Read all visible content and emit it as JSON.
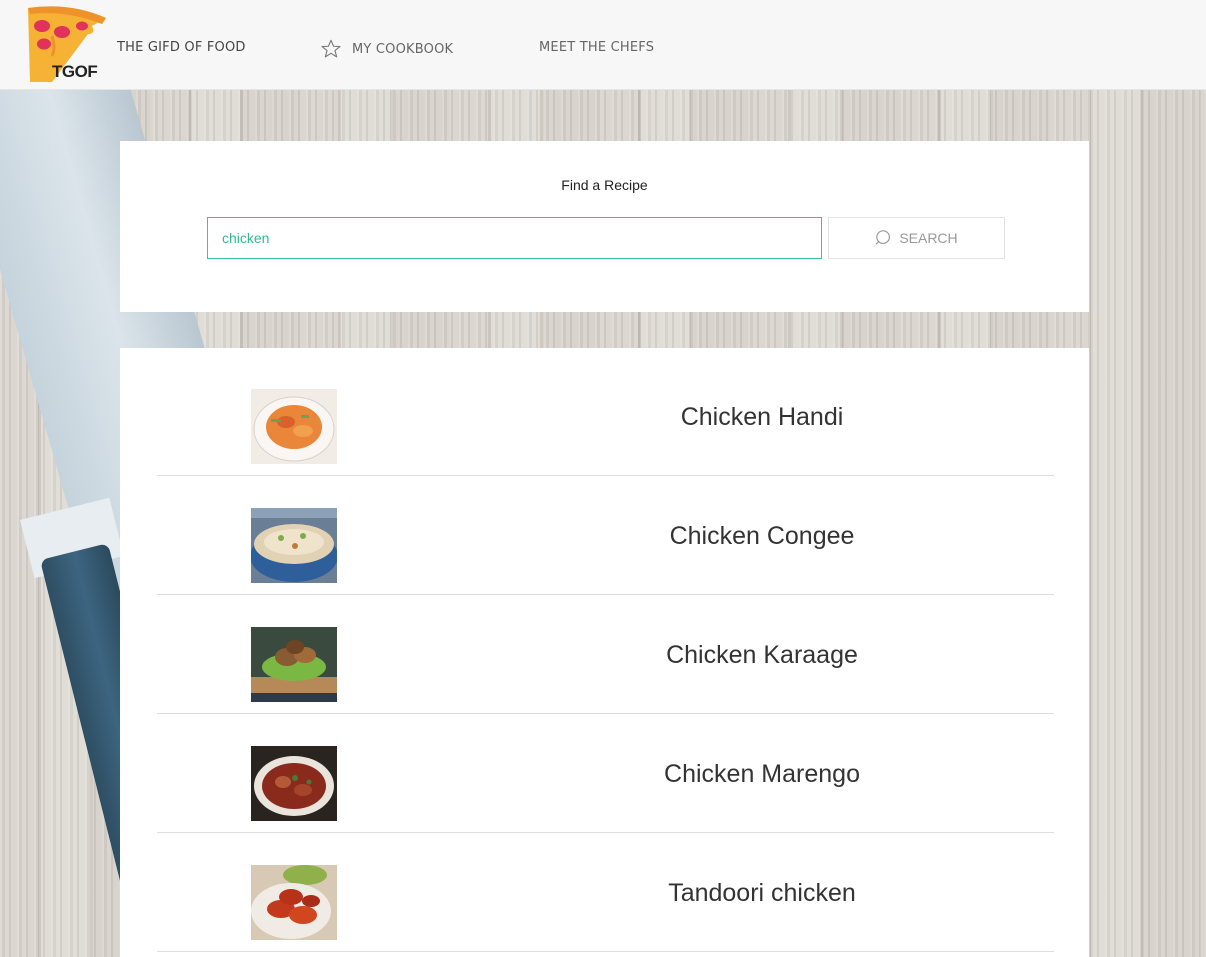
{
  "header": {
    "logo_text": "TGOF",
    "brand_link": "THE GIFD OF FOOD",
    "cookbook_link": "MY COOKBOOK",
    "chefs_link": "MEET THE CHEFS"
  },
  "search": {
    "title": "Find a Recipe",
    "query": "chicken",
    "button_label": "SEARCH"
  },
  "results": [
    {
      "name": "Chicken Handi",
      "icon": "food-photo"
    },
    {
      "name": "Chicken Congee",
      "icon": "food-photo"
    },
    {
      "name": "Chicken Karaage",
      "icon": "food-photo"
    },
    {
      "name": "Chicken Marengo",
      "icon": "food-photo"
    },
    {
      "name": "Tandoori chicken",
      "icon": "food-photo"
    }
  ],
  "colors": {
    "accent": "#3ec09a",
    "header_bg": "#f7f7f7",
    "knife_handle": "#3d6580"
  }
}
